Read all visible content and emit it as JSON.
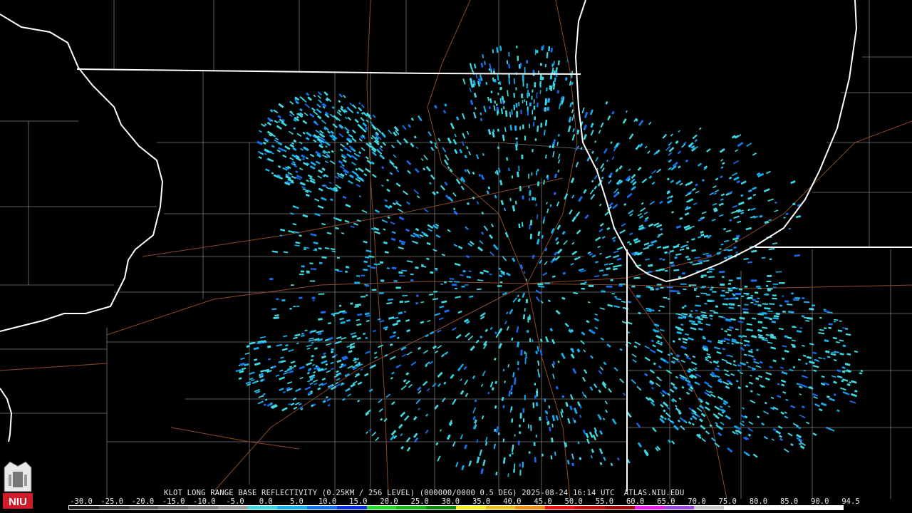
{
  "caption": {
    "product": "KLOT LONG RANGE BASE REFLECTIVITY",
    "levels": "(0.25KM / 256 LEVEL)",
    "volume": "(000000/0000",
    "elevation": "0.5 DEG)",
    "timestamp": "2025-08-24 16:14 UTC",
    "source": "ATLAS.NIU.EDU"
  },
  "logo": {
    "text": "NIU",
    "icon": "niu-logo-icon",
    "color": "#d11a2a"
  },
  "scale": {
    "labels": [
      "-30.0",
      "-25.0",
      "-20.0",
      "-15.0",
      "-10.0",
      "-5.0",
      "0.0",
      "5.0",
      "10.0",
      "15.0",
      "20.0",
      "25.0",
      "30.0",
      "35.0",
      "40.0",
      "45.0",
      "50.0",
      "55.0",
      "60.0",
      "65.0",
      "70.0",
      "75.0",
      "80.0",
      "85.0",
      "90.0",
      "94.5"
    ],
    "colors": [
      "#202020",
      "#3a3a3a",
      "#505050",
      "#6a6a6a",
      "#808080",
      "#9a9a9a",
      "#3fd8e0",
      "#16b0ee",
      "#1470f0",
      "#0a2ce0",
      "#1edc28",
      "#18b818",
      "#108a10",
      "#f4f020",
      "#e8c018",
      "#f08c10",
      "#f01010",
      "#c80c0c",
      "#a00808",
      "#f018f0",
      "#9848e0",
      "#c8c8c8",
      "#ffffff",
      "#ffffff",
      "#ffffff",
      "#ffffff"
    ]
  },
  "map": {
    "border_color": "#ffffff",
    "county_color": "#7a7a7a",
    "road_color": "#8a4a2a",
    "echo_colors": [
      "#3fd8e0",
      "#16b0ee",
      "#1470f0"
    ]
  }
}
